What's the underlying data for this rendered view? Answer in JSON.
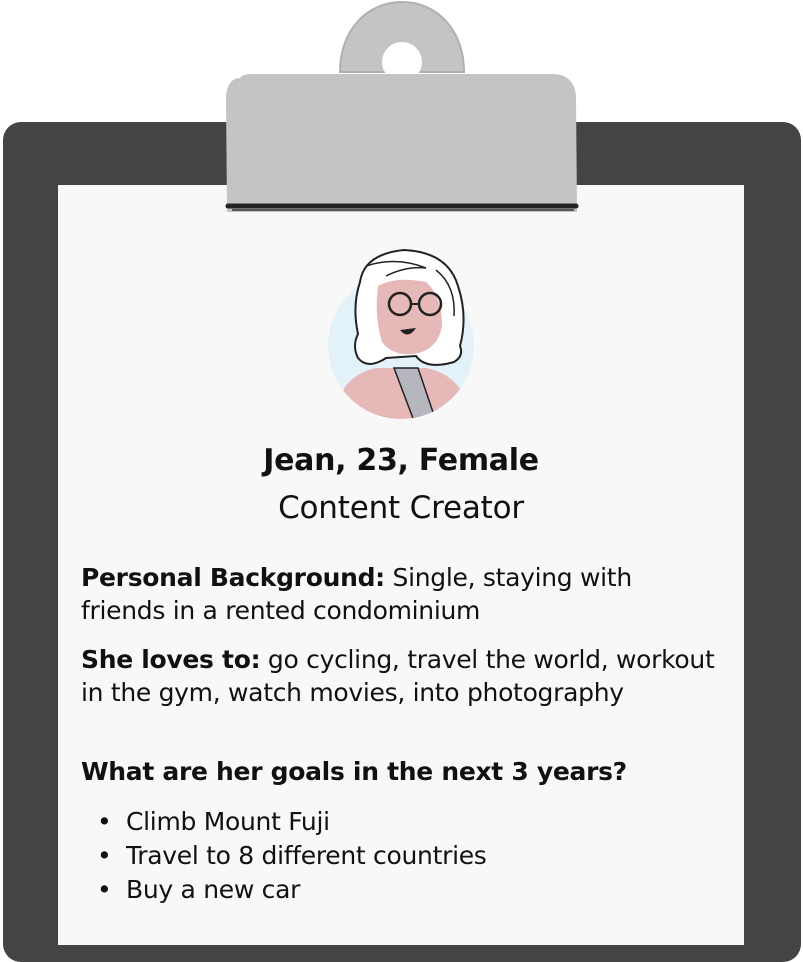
{
  "persona": {
    "name_line": "Jean, 23, Female",
    "role": "Content Creator",
    "background_label": "Personal Background:",
    "background_text": " Single, staying with friends in a rented condominium",
    "loves_label": "She loves to:",
    "loves_text": " go cycling, travel the world, workout in the gym, watch movies, into photography",
    "goals_heading": "What are her goals in the next 3 years?",
    "goals": [
      "Climb Mount Fuji",
      "Travel to 8 different countries",
      "Buy a new car"
    ]
  },
  "colors": {
    "board": "#444444",
    "paper": "#f8f8f8",
    "clip": "#c4c4c4",
    "avatar_bg": "#e3f2f8",
    "skin": "#e6b8b8"
  },
  "icons": [
    "clipboard-clip-icon",
    "avatar-woman-icon"
  ]
}
